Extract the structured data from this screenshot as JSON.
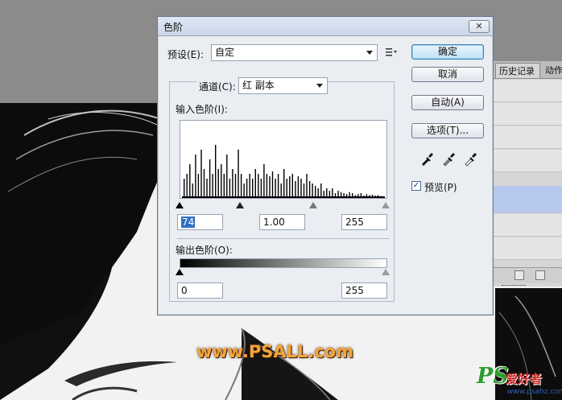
{
  "dialog": {
    "title": "色阶",
    "close_label": "✕",
    "preset": {
      "label": "预设(E):",
      "value": "自定"
    },
    "channel": {
      "label": "通道(C):",
      "value": "红 副本"
    },
    "input_levels_label": "输入色阶(I):",
    "input_values": {
      "black": "74",
      "gamma": "1.00",
      "white": "255"
    },
    "output_levels_label": "输出色阶(O):",
    "output_values": {
      "black": "0",
      "white": "255"
    },
    "buttons": {
      "ok": "确定",
      "cancel": "取消",
      "auto": "自动(A)",
      "options": "选项(T)..."
    },
    "preview": {
      "label": "预览(P)",
      "checked": true
    },
    "histogram_levels": [
      0.4,
      0.5,
      0.7,
      0.3,
      0.9,
      0.5,
      1.0,
      0.6,
      0.4,
      0.8,
      0.5,
      1.1,
      0.6,
      0.7,
      0.5,
      0.9,
      0.4,
      0.6,
      0.5,
      1.0,
      0.5,
      0.3,
      0.4,
      0.5,
      0.4,
      0.6,
      0.5,
      0.4,
      0.7,
      0.5,
      0.45,
      0.55,
      0.4,
      0.5,
      0.3,
      0.6,
      0.4,
      0.45,
      0.5,
      0.35,
      0.45,
      0.4,
      0.3,
      0.5,
      0.35,
      0.3,
      0.25,
      0.2,
      0.3,
      0.15,
      0.2,
      0.15,
      0.2,
      0.1,
      0.15,
      0.12,
      0.1,
      0.08,
      0.12,
      0.1,
      0.06,
      0.08,
      0.1,
      0.05,
      0.08,
      0.06,
      0.07,
      0.05,
      0.06,
      0.04
    ]
  },
  "panels": {
    "tab_history": "历史记录",
    "tab_actions": "动作"
  },
  "watermarks": {
    "center": "www.PSALL.com",
    "corner_logo": "PS",
    "corner_text": "爱好者",
    "corner_url": "www.psahz.com"
  },
  "colors": {
    "dialog_bg": "#eaedf2",
    "ok_button": "#bfe2f7",
    "selection_highlight": "#2f6fc3",
    "watermark_orange": "#f6a43c"
  }
}
